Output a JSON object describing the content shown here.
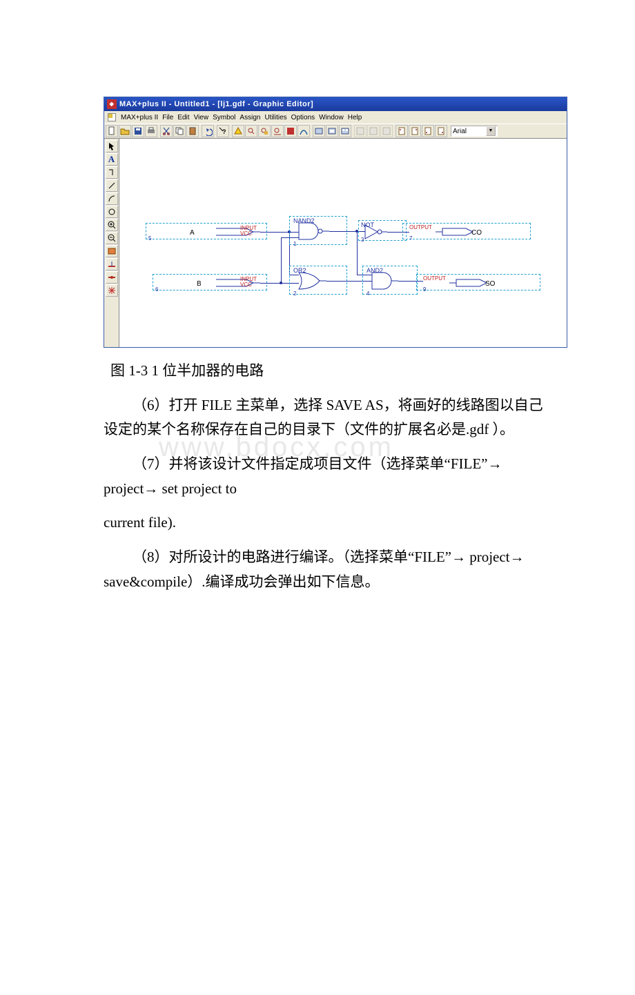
{
  "app": {
    "title": "MAX+plus II - Untitled1 - [lj1.gdf - Graphic Editor]",
    "menubar": [
      "MAX+plus II",
      "File",
      "Edit",
      "View",
      "Symbol",
      "Assign",
      "Utilities",
      "Options",
      "Window",
      "Help"
    ],
    "font_selected": "Arial",
    "toolbar_icons": [
      "new-file",
      "open-file",
      "save",
      "print",
      "cut",
      "copy",
      "paste",
      "undo",
      "help-context",
      "warning",
      "find",
      "replace",
      "search-again",
      "compile",
      "simulate",
      "timing",
      "hierarchy-up",
      "hierarchy-down",
      "hierarchy-project",
      "list1",
      "list2",
      "list3",
      "zoom-page1",
      "zoom-page2",
      "zoom-page3",
      "zoom-page4"
    ],
    "side_icons": [
      "select-arrow",
      "text-A",
      "ortho-line",
      "diag-line",
      "arc",
      "circle",
      "zoom-in",
      "zoom-out",
      "fit",
      "rubberband",
      "connect-dot",
      "asterisk"
    ]
  },
  "schematic": {
    "components": {
      "nand2": {
        "label": "NAND2",
        "ref": "1"
      },
      "not": {
        "label": "NOT",
        "ref": "3"
      },
      "or2": {
        "label": "OR2",
        "ref": "2"
      },
      "and2": {
        "label": "AND2",
        "ref": "4"
      }
    },
    "inputs": {
      "A": {
        "name": "A",
        "tag": "INPUT",
        "sub": "VCC",
        "ref": "5"
      },
      "B": {
        "name": "B",
        "tag": "INPUT",
        "sub": "VCC",
        "ref": "6"
      }
    },
    "outputs": {
      "CO": {
        "name": "CO",
        "tag": "OUTPUT",
        "ref": "7"
      },
      "SO": {
        "name": "SO",
        "tag": "OUTPUT",
        "ref": "9"
      }
    }
  },
  "doc": {
    "caption": "图 1-3 1 位半加器的电路",
    "p6": "（6）打开 FILE 主菜单，选择 SAVE AS，将画好的线路图以自己设定的某个名称保存在自己的目录下（文件的扩展名必是.gdf ）。",
    "p7a": "（7）并将该设计文件指定成项目文件（选择菜单“FILE”→ project→ set project to",
    "p7b": "current file).",
    "p8": "（8）对所设计的电路进行编译。（选择菜单“FILE”→ project→ save&compile）.编译成功会弹出如下信息。",
    "watermark": "www.bdocx.com"
  }
}
